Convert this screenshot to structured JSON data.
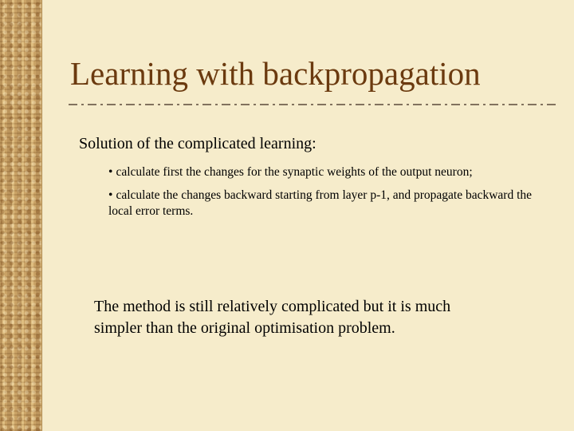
{
  "slide": {
    "title": "Learning with backpropagation",
    "subtitle": "Solution of the complicated learning:",
    "bullets": [
      {
        "marker": "•",
        "text": "calculate first the changes for the synaptic weights of the output neuron;"
      },
      {
        "marker": "•",
        "text": "calculate the changes backward starting from layer p-1, and propagate backward the local error terms."
      }
    ],
    "note": "The method is still relatively complicated but it is much simpler than the original optimisation problem."
  },
  "colors": {
    "background": "#f6eccb",
    "title": "#6b3a0f",
    "divider": "#5a4a3a"
  }
}
